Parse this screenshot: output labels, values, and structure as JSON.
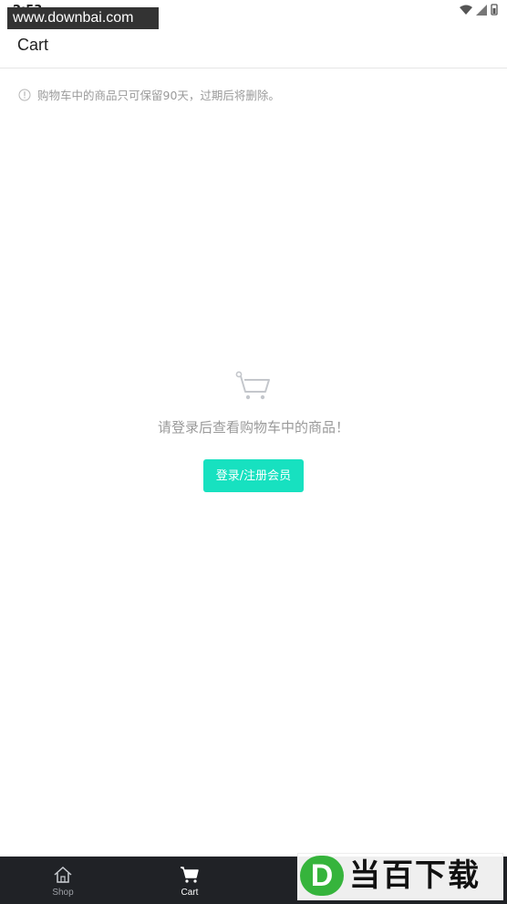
{
  "status_bar": {
    "time": "2:53"
  },
  "watermark_top": "www.downbai.com",
  "header": {
    "title": "Cart"
  },
  "notice": {
    "text": "购物车中的商品只可保留90天，过期后将删除。"
  },
  "empty_state": {
    "message": "请登录后查看购物车中的商品！",
    "button_label": "登录/注册会员"
  },
  "bottom_nav": {
    "items": [
      {
        "label": "Shop",
        "icon": "home-icon",
        "active": false
      },
      {
        "label": "Cart",
        "icon": "cart-icon",
        "active": true
      }
    ]
  },
  "logo_watermark": {
    "badge": "D",
    "text": "当百下载"
  },
  "colors": {
    "accent": "#17e1c0",
    "nav_bg": "#202226",
    "notice_text": "#9a9a9a"
  }
}
